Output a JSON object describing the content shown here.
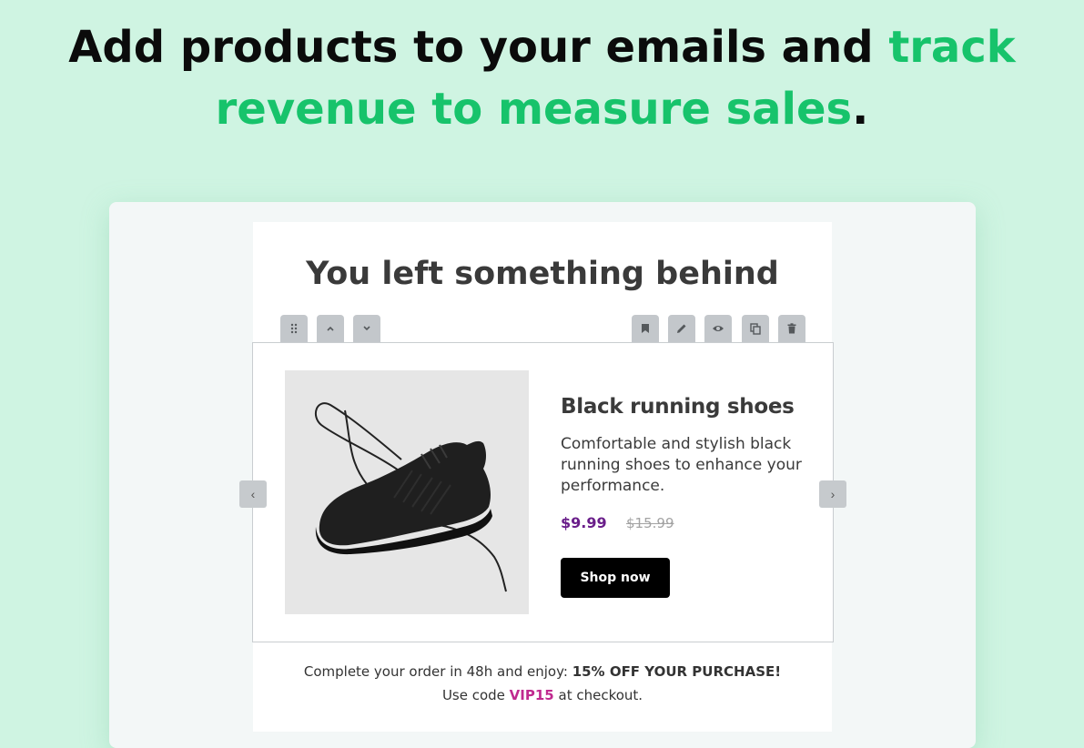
{
  "headline": {
    "text_before": "Add products to your emails and ",
    "accent": "track revenue to measure sales",
    "text_after": "."
  },
  "email": {
    "title": "You left something behind",
    "product": {
      "image_alt": "black-running-shoe",
      "name": "Black running shoes",
      "description": "Comfortable and stylish black running shoes to enhance your performance.",
      "price": "$9.99",
      "old_price": "$15.99",
      "button_label": "Shop now"
    },
    "footer": {
      "line1_prefix": "Complete your order in 48h and enjoy: ",
      "line1_bold": "15% OFF YOUR PURCHASE!",
      "line2_prefix": "Use code ",
      "code": "VIP15",
      "line2_suffix": " at checkout."
    }
  },
  "toolbar": {
    "left": [
      "drag-handle-icon",
      "move-up-icon",
      "move-down-icon"
    ],
    "right": [
      "bookmark-icon",
      "edit-icon",
      "preview-icon",
      "duplicate-icon",
      "delete-icon"
    ]
  },
  "carousel": {
    "prev_glyph": "‹",
    "next_glyph": "›"
  },
  "colors": {
    "background": "#cff4e2",
    "accent": "#17c36b",
    "price": "#6a1e8a",
    "code": "#c02a8f",
    "button": "#000000"
  }
}
